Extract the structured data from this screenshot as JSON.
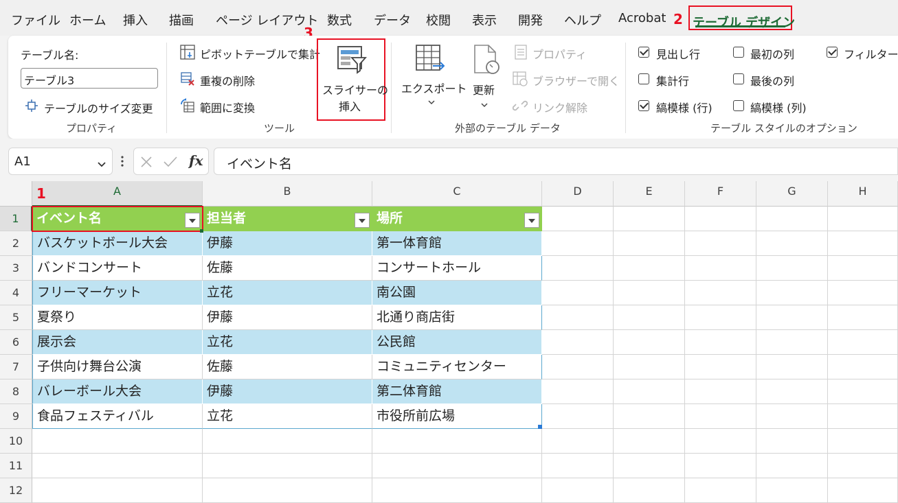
{
  "menu": {
    "tabs": [
      "ファイル",
      "ホーム",
      "挿入",
      "描画",
      "ページ レイアウト",
      "数式",
      "データ",
      "校閲",
      "表示",
      "開発",
      "ヘルプ",
      "Acrobat"
    ],
    "active_tab": "テーブル デザイン"
  },
  "annotations": {
    "n1": "1",
    "n2": "2",
    "n3": "3"
  },
  "ribbon": {
    "properties": {
      "name_label": "テーブル名:",
      "name_value": "テーブル3",
      "resize_label": "テーブルのサイズ変更",
      "group_label": "プロパティ"
    },
    "tools": {
      "pivot_label": "ピボットテーブルで集計",
      "remove_dup_label": "重複の削除",
      "convert_label": "範囲に変換",
      "slicer_line1": "スライサーの",
      "slicer_line2": "挿入",
      "group_label": "ツール"
    },
    "external": {
      "export_label": "エクスポート",
      "refresh_label": "更新",
      "properties_label": "プロパティ",
      "browser_label": "ブラウザーで開く",
      "unlink_label": "リンク解除",
      "group_label": "外部のテーブル データ"
    },
    "style_options": {
      "header_row": "見出し行",
      "total_row": "集計行",
      "banded_rows": "縞模様 (行)",
      "first_column": "最初の列",
      "last_column": "最後の列",
      "banded_columns": "縞模様 (列)",
      "filter_button": "フィルター ボ",
      "group_label": "テーブル スタイルのオプション",
      "checked": {
        "header_row": true,
        "total_row": false,
        "banded_rows": true,
        "first_column": false,
        "last_column": false,
        "banded_columns": false,
        "filter_button": true
      }
    }
  },
  "formula_bar": {
    "name_box": "A1",
    "fx": "fx",
    "formula": "イベント名"
  },
  "sheet": {
    "columns": [
      "A",
      "B",
      "C",
      "D",
      "E",
      "F",
      "G",
      "H"
    ],
    "rows": [
      "1",
      "2",
      "3",
      "4",
      "5",
      "6",
      "7",
      "8",
      "9",
      "10",
      "11",
      "12"
    ],
    "table_headers": [
      "イベント名",
      "担当者",
      "場所"
    ],
    "table_rows": [
      [
        "バスケットボール大会",
        "伊藤",
        "第一体育館"
      ],
      [
        "バンドコンサート",
        "佐藤",
        "コンサートホール"
      ],
      [
        "フリーマーケット",
        "立花",
        "南公園"
      ],
      [
        "夏祭り",
        "伊藤",
        "北通り商店街"
      ],
      [
        "展示会",
        "立花",
        "公民館"
      ],
      [
        "子供向け舞台公演",
        "佐藤",
        "コミュニティセンター"
      ],
      [
        "バレーボール大会",
        "伊藤",
        "第二体育館"
      ],
      [
        "食品フェスティバル",
        "立花",
        "市役所前広場"
      ]
    ]
  },
  "colors": {
    "header_green": "#92d050",
    "band_blue": "#bfe3f2",
    "accent": "#1e6b35",
    "highlight": "#e81123"
  }
}
